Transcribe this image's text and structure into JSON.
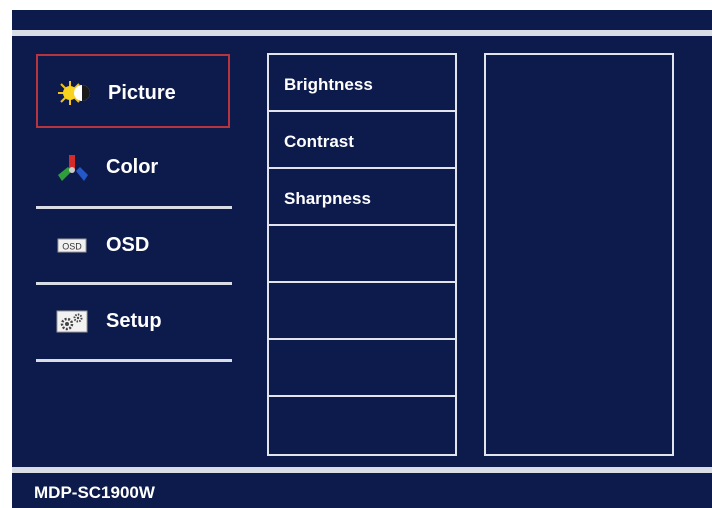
{
  "menu": {
    "items": [
      {
        "label": "Picture",
        "icon": "picture-brightness-icon",
        "selected": true
      },
      {
        "label": "Color",
        "icon": "color-rgb-icon",
        "selected": false
      },
      {
        "label": "OSD",
        "icon": "osd-icon",
        "selected": false
      },
      {
        "label": "Setup",
        "icon": "setup-gears-icon",
        "selected": false
      }
    ]
  },
  "submenu": {
    "rows": [
      "Brightness",
      "Contrast",
      "Sharpness",
      "",
      "",
      "",
      ""
    ]
  },
  "footer": {
    "model": "MDP-SC1900W"
  },
  "colors": {
    "background": "#0d1b4c",
    "lines": "#d9dde6",
    "selection": "#b5343d"
  }
}
